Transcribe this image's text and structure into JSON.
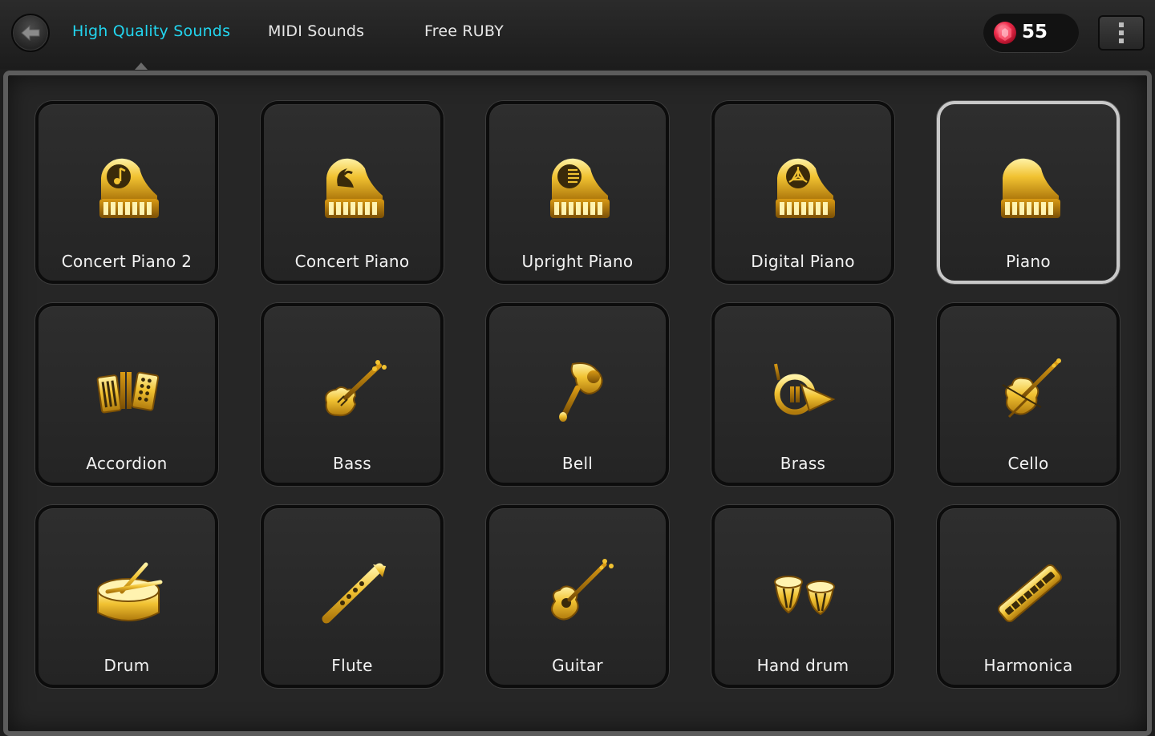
{
  "header": {
    "tabs": [
      {
        "label": "High Quality Sounds",
        "active": true
      },
      {
        "label": "MIDI Sounds",
        "active": false
      },
      {
        "label": "Free RUBY",
        "active": false
      }
    ],
    "ruby_count": "55"
  },
  "colors": {
    "active_tab": "#22d6f0",
    "gold": "#e8b820",
    "ruby": "#ee2b4a"
  },
  "instruments": [
    {
      "label": "Concert Piano 2",
      "icon": "grand-piano-note-icon",
      "selected": false
    },
    {
      "label": "Concert Piano",
      "icon": "grand-piano-wave-icon",
      "selected": false
    },
    {
      "label": "Upright Piano",
      "icon": "grand-piano-lines-icon",
      "selected": false
    },
    {
      "label": "Digital Piano",
      "icon": "grand-piano-tri-icon",
      "selected": false
    },
    {
      "label": "Piano",
      "icon": "grand-piano-icon",
      "selected": true
    },
    {
      "label": "Accordion",
      "icon": "accordion-icon",
      "selected": false
    },
    {
      "label": "Bass",
      "icon": "electric-bass-icon",
      "selected": false
    },
    {
      "label": "Bell",
      "icon": "handbell-icon",
      "selected": false
    },
    {
      "label": "Brass",
      "icon": "french-horn-icon",
      "selected": false
    },
    {
      "label": "Cello",
      "icon": "cello-icon",
      "selected": false
    },
    {
      "label": "Drum",
      "icon": "drum-icon",
      "selected": false
    },
    {
      "label": "Flute",
      "icon": "flute-icon",
      "selected": false
    },
    {
      "label": "Guitar",
      "icon": "acoustic-guitar-icon",
      "selected": false
    },
    {
      "label": "Hand drum",
      "icon": "bongo-drums-icon",
      "selected": false
    },
    {
      "label": "Harmonica",
      "icon": "harmonica-icon",
      "selected": false
    }
  ]
}
